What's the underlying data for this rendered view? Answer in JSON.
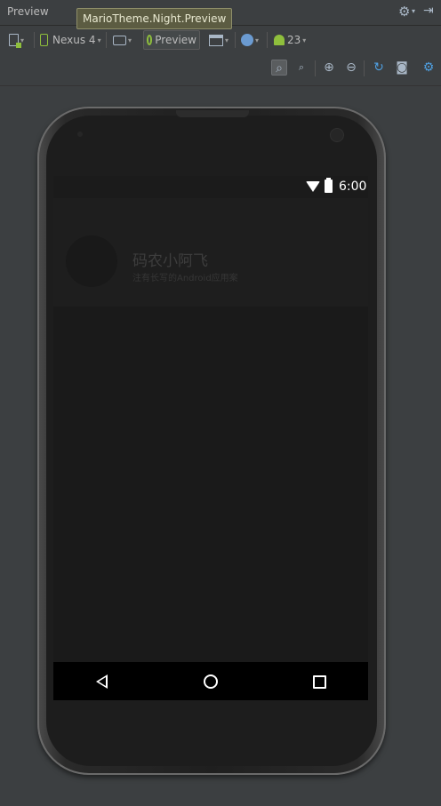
{
  "panel": {
    "title": "Preview",
    "tooltip": "MarioTheme.Night.Preview"
  },
  "toolbar": {
    "device_label": "Nexus 4",
    "theme_label": "Preview",
    "api_level": "23"
  },
  "device": {
    "status_bar": {
      "time": "6:00"
    },
    "app_bar": {
      "title": "码农小阿飞",
      "subtitle": "注有长写的Android应用案"
    }
  },
  "colors": {
    "ide_background": "#3c3f41",
    "screen_background": "#1a1a1a",
    "nav_bar": "#000000",
    "android_green": "#8fbf3c",
    "tooltip_bg": "#5c5c42"
  }
}
